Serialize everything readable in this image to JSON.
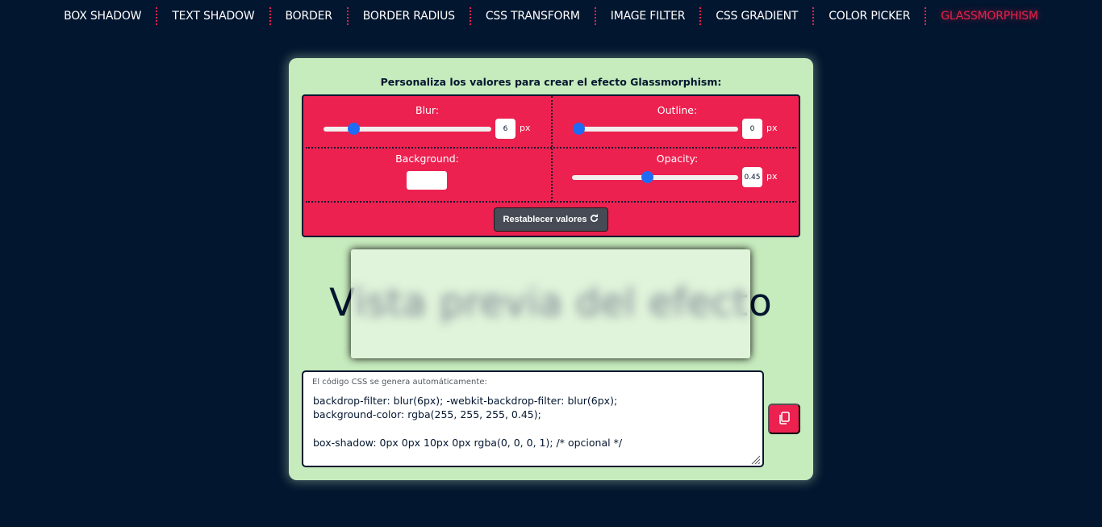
{
  "nav": {
    "items": [
      {
        "label": "BOX SHADOW"
      },
      {
        "label": "TEXT SHADOW"
      },
      {
        "label": "BORDER"
      },
      {
        "label": "BORDER RADIUS"
      },
      {
        "label": "CSS TRANSFORM"
      },
      {
        "label": "IMAGE FILTER"
      },
      {
        "label": "CSS GRADIENT"
      },
      {
        "label": "COLOR PICKER"
      },
      {
        "label": "GLASSMORPHISM"
      }
    ],
    "active_index": 8
  },
  "panel": {
    "title": "Personaliza los valores para crear el efecto Glassmorphism:",
    "blur": {
      "label": "Blur:",
      "value": "6",
      "unit": "px",
      "fraction": 0.18
    },
    "outline": {
      "label": "Outline:",
      "value": "0",
      "unit": "px",
      "fraction": 0.0
    },
    "background": {
      "label": "Background:",
      "color": "#ffffff"
    },
    "opacity": {
      "label": "Opacity:",
      "value": "0.45",
      "unit": "px",
      "fraction": 0.45
    },
    "reset_label": "Restablecer valores",
    "reset_icon": "refresh-icon"
  },
  "preview": {
    "text": "Vista previa del efecto"
  },
  "code": {
    "hint": "El código CSS se genera automáticamente:",
    "line1": "backdrop-filter:  blur(6px); -webkit-backdrop-filter:  blur(6px);",
    "line2": "background-color: rgba(255, 255, 255, 0.45);",
    "line3": "box-shadow:  0px 0px 10px 0px rgba(0, 0, 0, 1); /* opcional */",
    "copy_icon": "copy-icon"
  },
  "colors": {
    "page_bg": "#03162f",
    "card_bg": "#c6ebbd",
    "accent": "#ec2150",
    "slider_thumb": "#1e6cf5"
  }
}
